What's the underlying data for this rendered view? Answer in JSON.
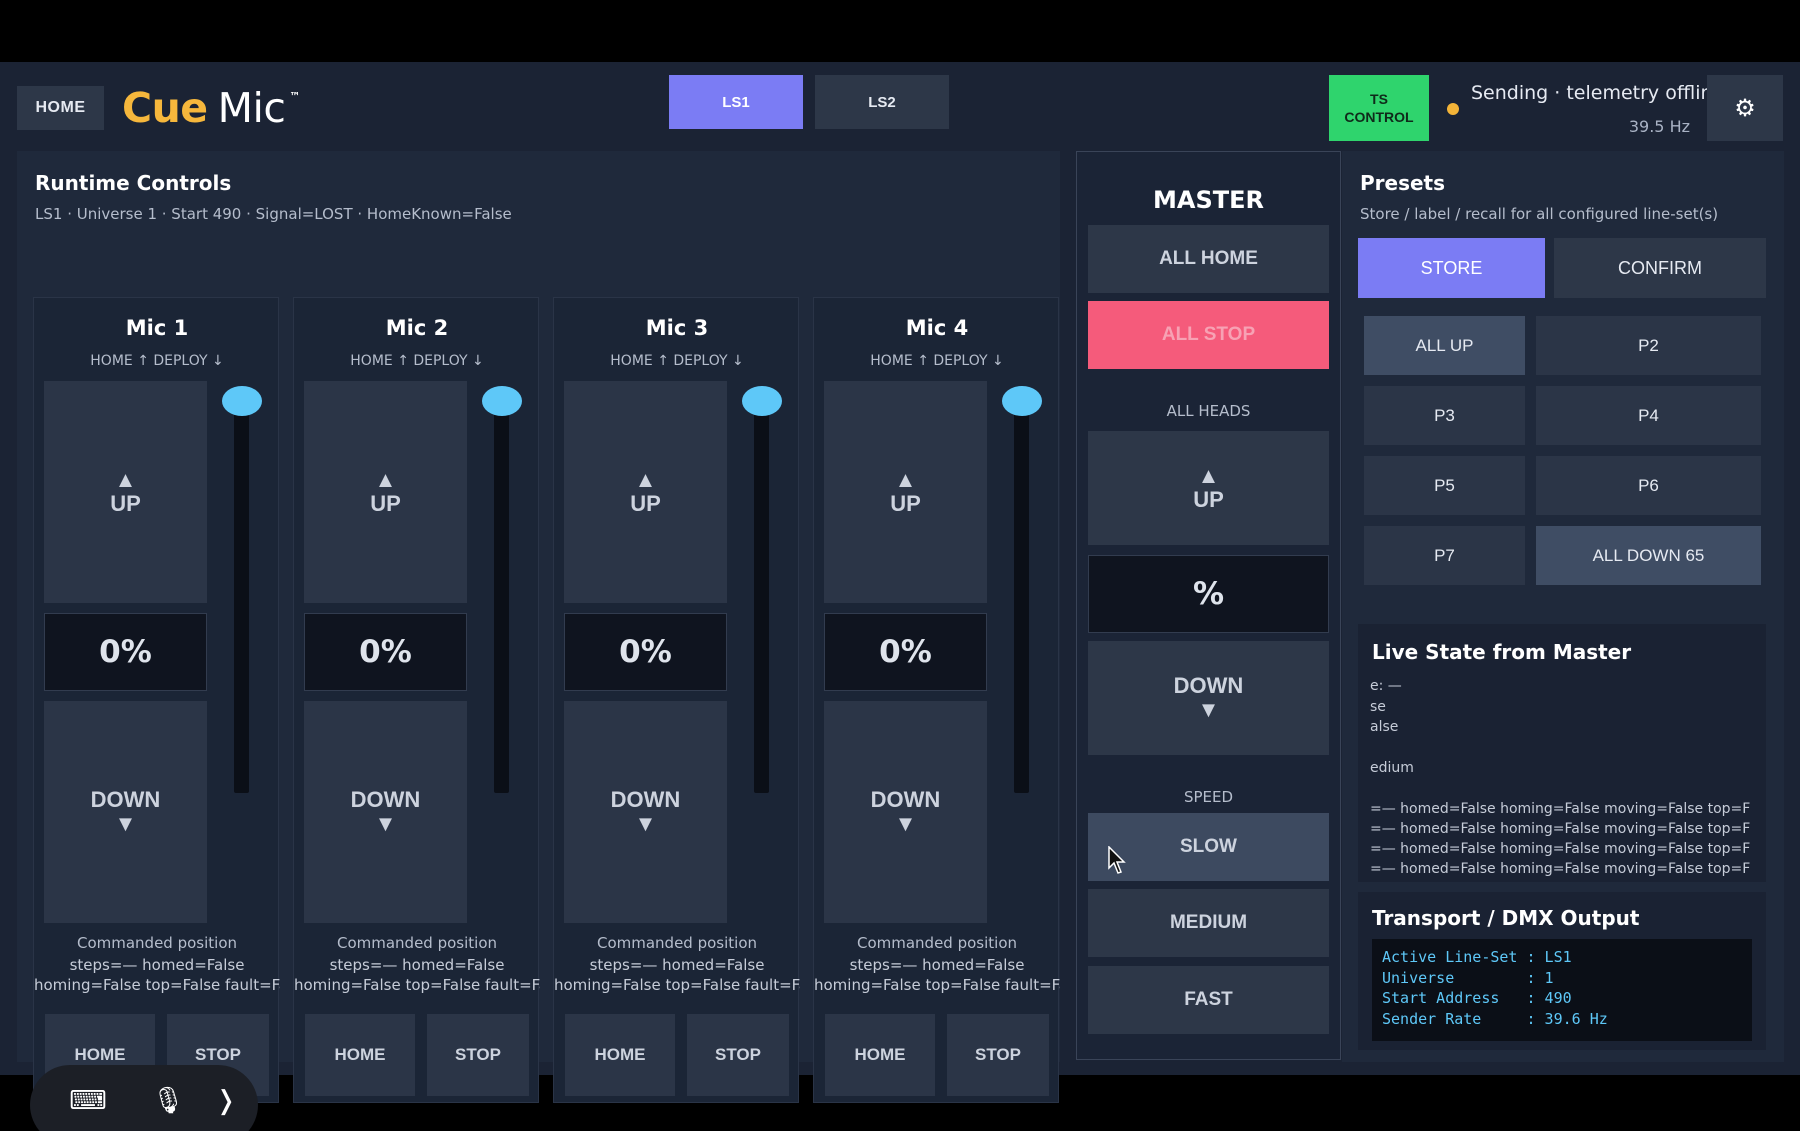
{
  "header": {
    "home_label": "HOME",
    "logo_cue": "Cue",
    "logo_mic": "Mic",
    "logo_tm": "™",
    "tabs": [
      {
        "label": "LS1"
      },
      {
        "label": "LS2"
      }
    ],
    "ts_control": {
      "line1": "TS",
      "line2": "CONTROL"
    },
    "status_text": "Sending · telemetry offline",
    "status_hz": "39.5 Hz",
    "gear_icon": "⚙"
  },
  "runtime": {
    "title": "Runtime Controls",
    "subtitle": "LS1 · Universe 1 · Start 490 · Signal=LOST · HomeKnown=False",
    "mics": [
      {
        "name": "Mic 1",
        "hd": "HOME ↑   DEPLOY ↓",
        "up": "UP",
        "pct": "0%",
        "down": "DOWN",
        "cmd": "Commanded position",
        "steps": "steps=—  homed=False",
        "flags": "homing=False  top=False  fault=False",
        "home": "HOME",
        "stop": "STOP"
      },
      {
        "name": "Mic 2",
        "hd": "HOME ↑   DEPLOY ↓",
        "up": "UP",
        "pct": "0%",
        "down": "DOWN",
        "cmd": "Commanded position",
        "steps": "steps=—  homed=False",
        "flags": "homing=False  top=False  fault=False",
        "home": "HOME",
        "stop": "STOP"
      },
      {
        "name": "Mic 3",
        "hd": "HOME ↑   DEPLOY ↓",
        "up": "UP",
        "pct": "0%",
        "down": "DOWN",
        "cmd": "Commanded position",
        "steps": "steps=—  homed=False",
        "flags": "homing=False  top=False  fault=False",
        "home": "HOME",
        "stop": "STOP"
      },
      {
        "name": "Mic 4",
        "hd": "HOME ↑   DEPLOY ↓",
        "up": "UP",
        "pct": "0%",
        "down": "DOWN",
        "cmd": "Commanded position",
        "steps": "steps=—  homed=False",
        "flags": "homing=False  top=False  fault=False",
        "home": "HOME",
        "stop": "STOP"
      }
    ],
    "arrow_up": "▲",
    "arrow_down": "▼"
  },
  "master": {
    "title": "MASTER",
    "all_home": "ALL HOME",
    "all_stop": "ALL STOP",
    "heads_label": "ALL HEADS",
    "up": "UP",
    "pct": "%",
    "down": "DOWN",
    "speed_label": "SPEED",
    "slow": "SLOW",
    "medium": "MEDIUM",
    "fast": "FAST"
  },
  "presets": {
    "title": "Presets",
    "subtitle": "Store / label / recall for all configured line-set(s)",
    "store": "STORE",
    "confirm": "CONFIRM",
    "slots": [
      "ALL UP",
      "P2",
      "P3",
      "P4",
      "P5",
      "P6",
      "P7",
      "ALL DOWN 65"
    ]
  },
  "live_state": {
    "title": "Live State from Master",
    "lines": [
      "e: —",
      "se",
      "alse",
      "",
      "edium",
      "",
      "=— homed=False homing=False moving=False top=F",
      "=— homed=False homing=False moving=False top=F",
      "=— homed=False homing=False moving=False top=F",
      "=— homed=False homing=False moving=False top=F"
    ]
  },
  "transport": {
    "title": "Transport / DMX Output",
    "text": "Active Line-Set : LS1\nUniverse        : 1\nStart Address   : 490\nSender Rate     : 39.6 Hz"
  },
  "taskbar": {
    "keyboard_icon": "⌨",
    "mic_icon": "🎙",
    "chevron_icon": "❭"
  },
  "colors": {
    "accent": "#7b7cf4",
    "ts_green": "#2fd46d",
    "stop_red": "#f55b7b",
    "slider": "#5ec8f8",
    "status_dot": "#f4b438"
  }
}
